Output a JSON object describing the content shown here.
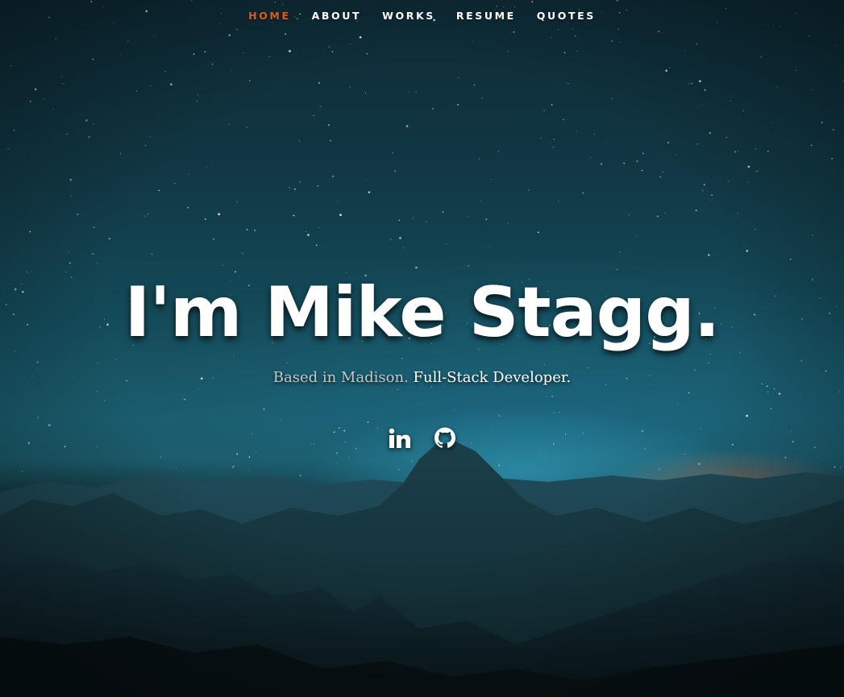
{
  "nav": {
    "items": [
      {
        "label": "HOME",
        "current": true
      },
      {
        "label": "ABOUT",
        "current": false
      },
      {
        "label": "WORKS",
        "current": false
      },
      {
        "label": "RESUME",
        "current": false
      },
      {
        "label": "QUOTES",
        "current": false
      }
    ],
    "active_color": "#e05a1f"
  },
  "hero": {
    "title": "I'm Mike Stagg.",
    "subtitle_location": "Based in Madison.",
    "subtitle_role": "Full-Stack Developer."
  },
  "social": {
    "icons": [
      "linkedin-icon",
      "github-icon"
    ]
  }
}
